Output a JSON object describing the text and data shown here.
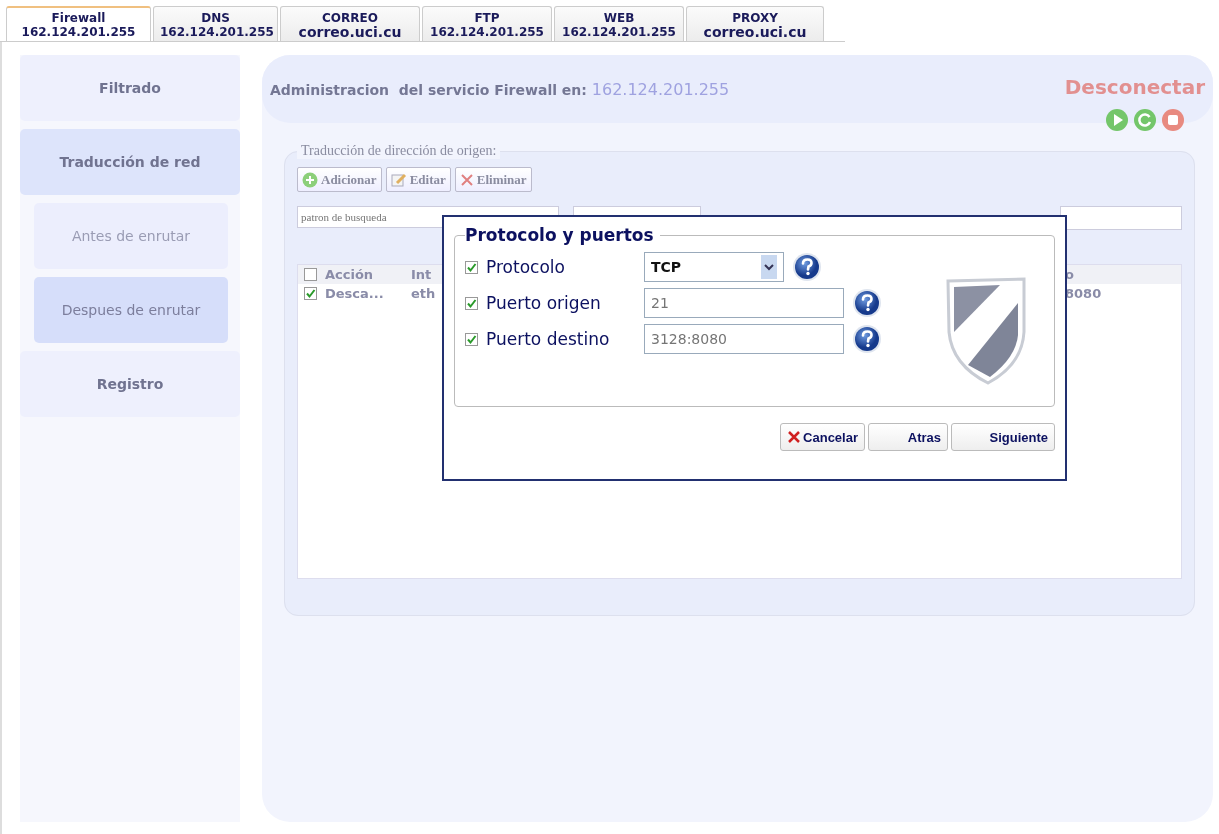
{
  "tabs": [
    {
      "service": "Firewall",
      "host": "162.124.201.255",
      "selected": true
    },
    {
      "service": "DNS",
      "host": "162.124.201.255",
      "selected": false
    },
    {
      "service": "CORREO",
      "host": "correo.uci.cu",
      "selected": false
    },
    {
      "service": "FTP",
      "host": "162.124.201.255",
      "selected": false
    },
    {
      "service": "WEB",
      "host": "162.124.201.255",
      "selected": false
    },
    {
      "service": "PROXY",
      "host": "correo.uci.cu",
      "selected": false
    }
  ],
  "sidebar": {
    "items": [
      {
        "label": "Filtrado",
        "selected": false
      },
      {
        "label": "Traducción de red",
        "selected": true,
        "children": [
          {
            "label": "Antes de enrutar",
            "selected": false
          },
          {
            "label": "Despues de enrutar",
            "selected": true
          }
        ]
      },
      {
        "label": "Registro",
        "selected": false
      }
    ]
  },
  "header": {
    "title": "Administracion  del servicio Firewall en:",
    "address": "162.124.201.255",
    "disconnect": "Desconectar"
  },
  "panel": {
    "legend": "Traducción de dirección de origen:",
    "toolbar": [
      {
        "kind": "add",
        "label": "Adicionar"
      },
      {
        "kind": "edit",
        "label": "Editar"
      },
      {
        "kind": "delete",
        "label": "Eliminar"
      }
    ],
    "search": {
      "placeholder": "patron de busqueda"
    },
    "table": {
      "all_checked": false,
      "columns": [
        "Acción",
        "Int",
        "o"
      ],
      "rows": [
        {
          "checked": true,
          "cells": [
            "Desca...",
            "eth",
            "8080"
          ]
        }
      ]
    }
  },
  "dialog": {
    "title": "Protocolo y puertos",
    "fields": [
      {
        "kind": "select",
        "label": "Protocolo",
        "checked": true,
        "value": "TCP"
      },
      {
        "kind": "input",
        "label": "Puerto origen",
        "checked": true,
        "placeholder": "21"
      },
      {
        "kind": "input",
        "label": "Puerto destino",
        "checked": true,
        "placeholder": "3128:8080"
      }
    ],
    "buttons": [
      {
        "kind": "cancel",
        "label": "Cancelar"
      },
      {
        "kind": "back",
        "label": "Atras"
      },
      {
        "kind": "next",
        "label": "Siguiente"
      }
    ]
  }
}
